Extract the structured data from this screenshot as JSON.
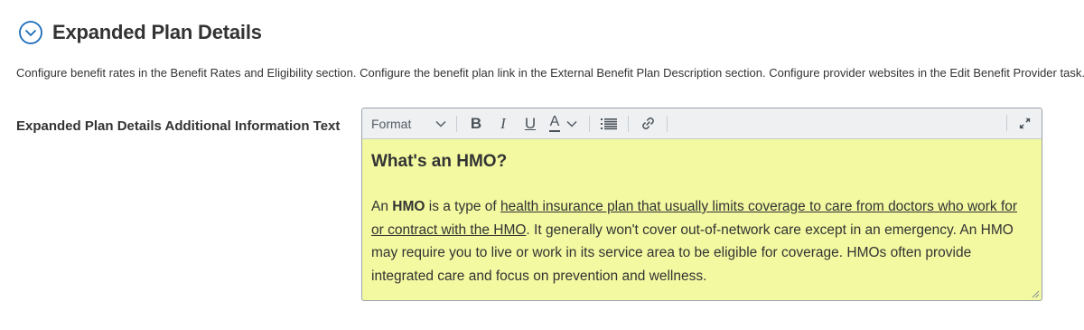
{
  "section": {
    "title": "Expanded Plan Details",
    "description": "Configure benefit rates in the Benefit Rates and Eligibility section. Configure the benefit plan link in the External Benefit Plan Description section. Configure provider websites in the Edit Benefit Provider task."
  },
  "field": {
    "label": "Expanded Plan Details Additional Information Text"
  },
  "editor": {
    "toolbar": {
      "format_label": "Format",
      "bold_label": "B",
      "italic_label": "I",
      "underline_label": "U",
      "font_color_label": "A"
    },
    "content": {
      "heading": "What's an HMO?",
      "para_prefix": "An ",
      "para_bold": "HMO",
      "para_mid": " is a type of ",
      "para_link": "health insurance plan that usually limits coverage to care from doctors who work for or contract with the HMO",
      "para_rest": ". It generally won't cover out-of-network care except in an emergency. An HMO may require you to live or work in its service area to be eligible for coverage. HMOs often provide integrated care and focus on prevention and wellness."
    },
    "background_color": "#f2f9a0"
  },
  "colors": {
    "accent": "#1a6bb8",
    "text": "#333333"
  }
}
